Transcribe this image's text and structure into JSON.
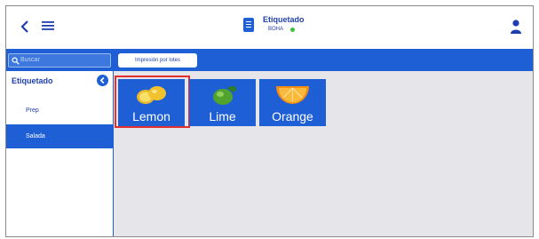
{
  "header": {
    "title": "Etiquetado",
    "subtitle": "BOHA",
    "status_color": "#39c43b",
    "icons": {
      "back": "chevron-left-icon",
      "menu": "hamburger-menu-icon",
      "document": "document-icon",
      "user": "user-icon"
    }
  },
  "toolbar": {
    "search_placeholder": "Buscar",
    "batch_print_label": "Impresión por lotes"
  },
  "sidebar": {
    "title": "Etiquetado",
    "items": [
      {
        "label": "Prep",
        "active": false
      },
      {
        "label": "Salada",
        "active": true
      }
    ]
  },
  "products": [
    {
      "label": "Lemon",
      "icon": "lemon-icon",
      "selected": true
    },
    {
      "label": "Lime",
      "icon": "lime-icon",
      "selected": false
    },
    {
      "label": "Orange",
      "icon": "orange-slice-icon",
      "selected": false
    }
  ],
  "colors": {
    "accent": "#1f5fd6",
    "selection": "#e23030",
    "background": "#e5e5ea"
  }
}
